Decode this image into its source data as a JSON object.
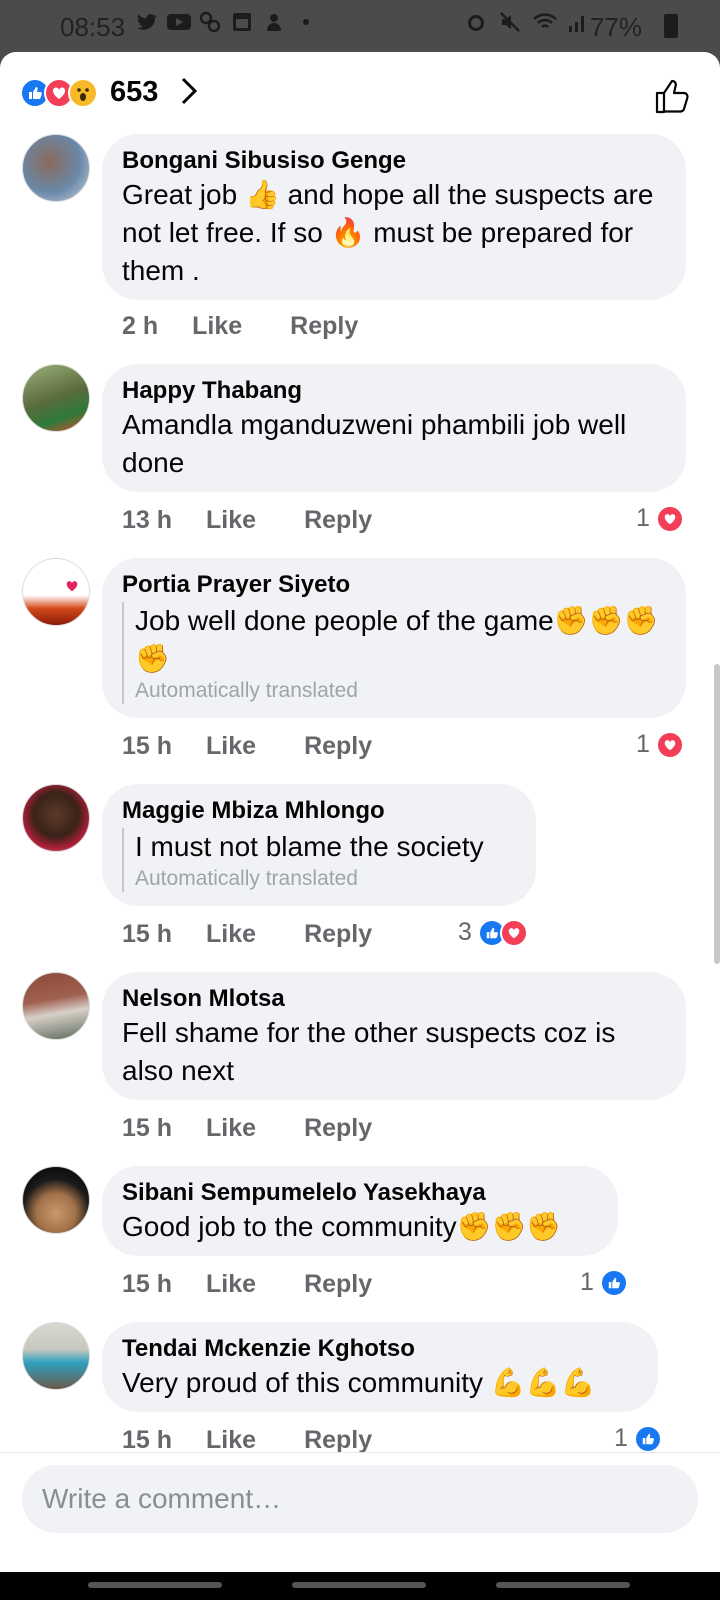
{
  "status_bar": {
    "time": "08:53",
    "battery": "77%",
    "left_icons": [
      "twitter-icon",
      "youtube-icon",
      "app-icon",
      "calendar-icon",
      "notification-icon",
      "dot-icon"
    ],
    "right_icons": [
      "alarm-icon",
      "mute-icon",
      "wifi-icon",
      "signal-icon"
    ]
  },
  "reactions": {
    "count": "653",
    "types": [
      "like",
      "love",
      "wow"
    ]
  },
  "comments": [
    {
      "author": "Bongani Sibusiso Genge",
      "text_parts": [
        "Great job ",
        "👍",
        " and hope all the suspects are not let free. If so ",
        "🔥",
        " must be prepared for them ."
      ],
      "time": "2 h",
      "like": "Like",
      "reply": "Reply"
    },
    {
      "author": "Happy Thabang",
      "text": "Amandla mganduzweni phambili job well done",
      "time": "13 h",
      "like": "Like",
      "reply": "Reply",
      "reaction_count": "1"
    },
    {
      "author": "Portia Prayer Siyeto",
      "text": "Job well done people of the game✊✊✊✊",
      "translated_note": "Automatically translated",
      "time": "15 h",
      "like": "Like",
      "reply": "Reply",
      "reaction_count": "1"
    },
    {
      "author": "Maggie Mbiza Mhlongo",
      "text": "I must not blame the society",
      "translated_note": "Automatically translated",
      "time": "15 h",
      "like": "Like",
      "reply": "Reply",
      "reaction_count": "3"
    },
    {
      "author": "Nelson Mlotsa",
      "text": "Fell shame for the other suspects coz is also next",
      "time": "15 h",
      "like": "Like",
      "reply": "Reply"
    },
    {
      "author": "Sibani Sempumelelo Yasekhaya",
      "text": "Good job to the community✊✊✊",
      "time": "15 h",
      "like": "Like",
      "reply": "Reply",
      "reaction_count": "1"
    },
    {
      "author": "Tendai Mckenzie Kghotso",
      "text": "Very proud of this community 💪💪💪",
      "time": "15 h",
      "like": "Like",
      "reply": "Reply",
      "reaction_count": "1"
    }
  ],
  "composer": {
    "placeholder": "Write a comment…"
  },
  "colors": {
    "facebook_blue": "#1877f2",
    "love_red": "#f33e58",
    "bubble_gray": "#f0f2f5",
    "meta_gray": "#65676b"
  }
}
